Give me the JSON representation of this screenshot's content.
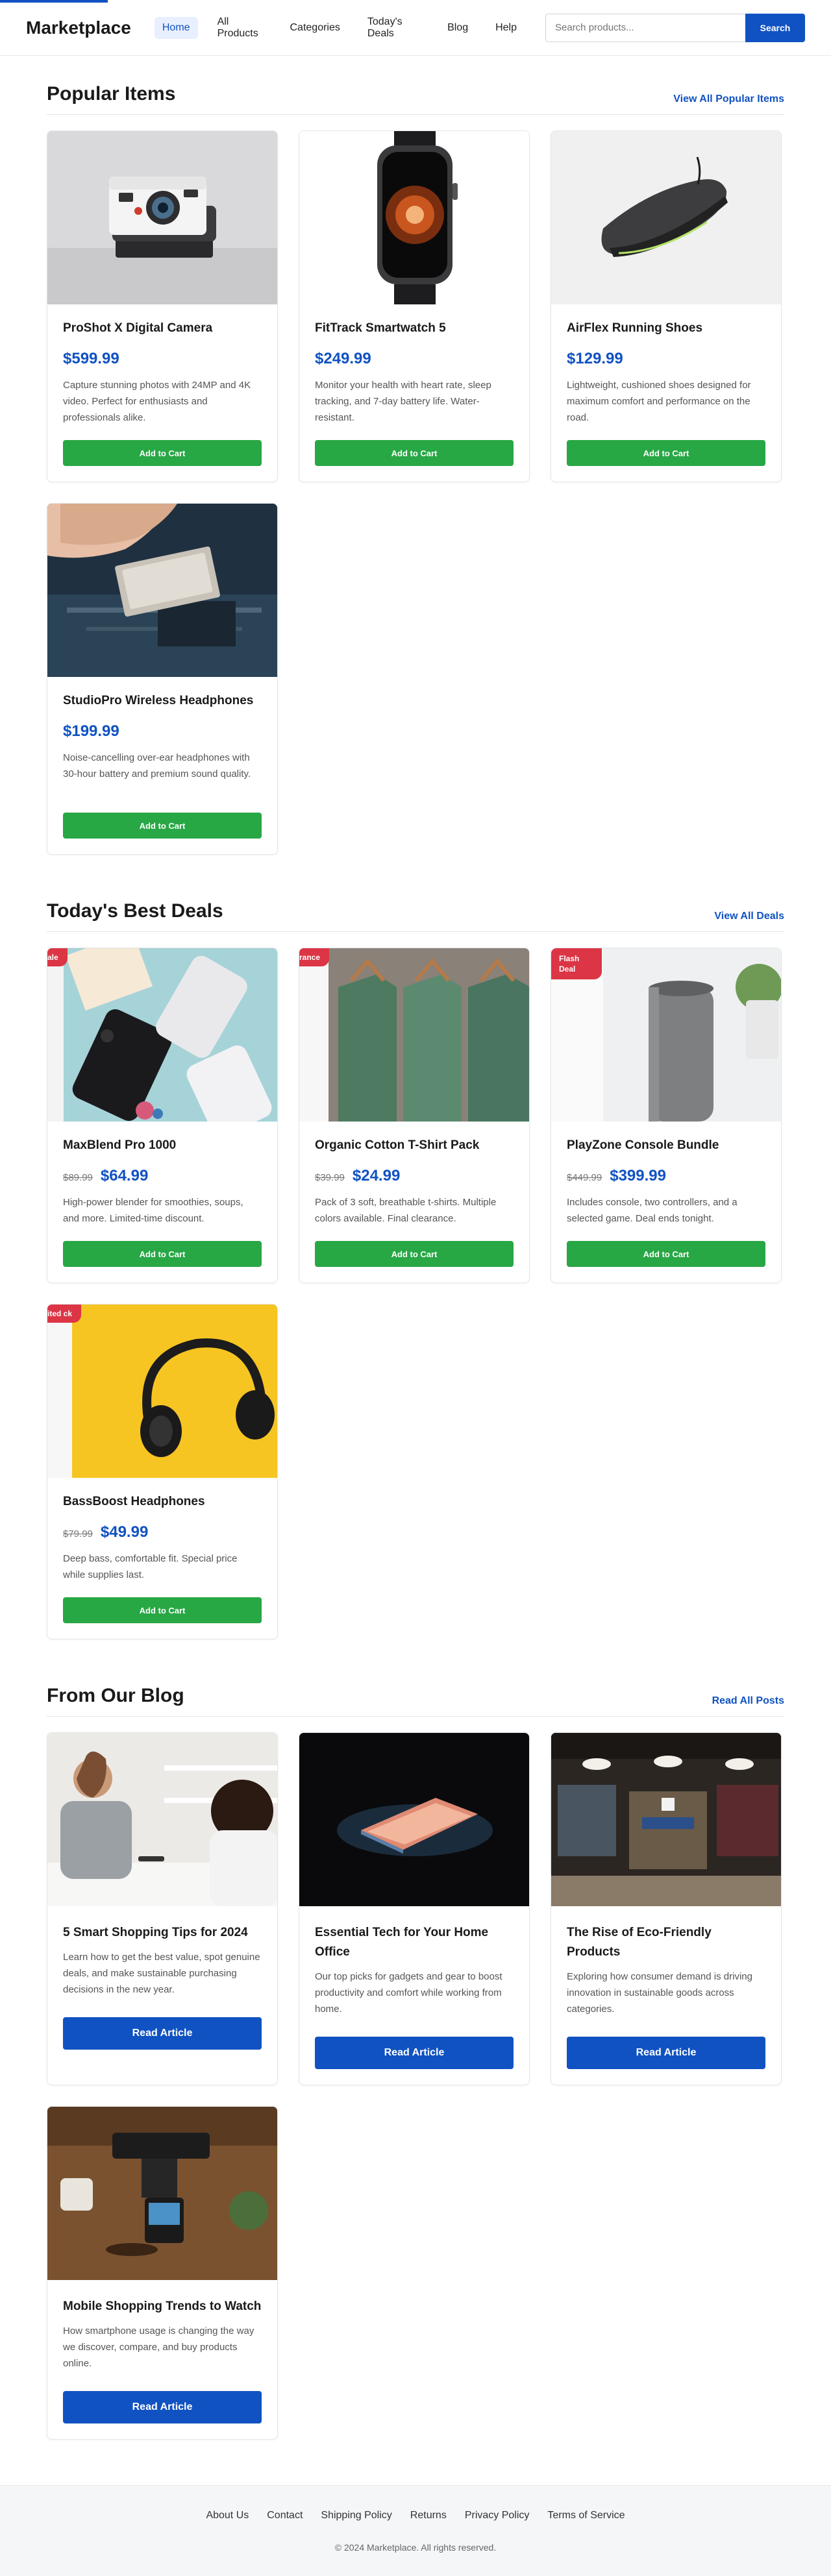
{
  "progress": {
    "fraction": 0.13
  },
  "header": {
    "logo": "Marketplace",
    "nav": [
      "Home",
      "All Products",
      "Categories",
      "Today's Deals",
      "Blog",
      "Help"
    ],
    "search_placeholder": "Search products...",
    "search_button": "Search"
  },
  "popular": {
    "title": "Popular Items",
    "link": "View All Popular Items",
    "items": [
      {
        "name": "ProShot X Digital Camera",
        "price": "$599.99",
        "desc": "Capture stunning photos with 24MP and 4K video. Perfect for enthusiasts and professionals alike.",
        "button": "Add to Cart",
        "image": "camera"
      },
      {
        "name": "FitTrack Smartwatch 5",
        "price": "$249.99",
        "desc": "Monitor your health with heart rate, sleep tracking, and 7-day battery life. Water-resistant.",
        "button": "Add to Cart",
        "image": "smartwatch"
      },
      {
        "name": "AirFlex Running Shoes",
        "price": "$129.99",
        "desc": "Lightweight, cushioned shoes designed for maximum comfort and performance on the road.",
        "button": "Add to Cart",
        "image": "running-shoe"
      },
      {
        "name": "StudioPro Wireless Headphones",
        "price": "$199.99",
        "desc": "Noise-cancelling over-ear headphones with 30-hour battery and premium sound quality.",
        "button": "Add to Cart",
        "image": "circuit-board"
      }
    ]
  },
  "deals": {
    "title": "Today's Best Deals",
    "link": "View All Deals",
    "items": [
      {
        "badge": "ale",
        "name": "MaxBlend Pro 1000",
        "old_price": "$89.99",
        "price": "$64.99",
        "desc": "High-power blender for smoothies, soups, and more. Limited-time discount.",
        "button": "Add to Cart",
        "image": "phones"
      },
      {
        "badge": "rance",
        "name": "Organic Cotton T-Shirt Pack",
        "old_price": "$39.99",
        "price": "$24.99",
        "desc": "Pack of 3 soft, breathable t-shirts. Multiple colors available. Final clearance.",
        "button": "Add to Cart",
        "image": "t-shirts"
      },
      {
        "badge": "Flash Deal",
        "name": "PlayZone Console Bundle",
        "old_price": "$449.99",
        "price": "$399.99",
        "desc": "Includes console, two controllers, and a selected game. Deal ends tonight.",
        "button": "Add to Cart",
        "image": "smart-speaker"
      },
      {
        "badge": "ited ck",
        "name": "BassBoost Headphones",
        "old_price": "$79.99",
        "price": "$49.99",
        "desc": "Deep bass, comfortable fit. Special price while supplies last.",
        "button": "Add to Cart",
        "image": "headphones"
      }
    ]
  },
  "blog": {
    "title": "From Our Blog",
    "link": "Read All Posts",
    "posts": [
      {
        "title": "5 Smart Shopping Tips for 2024",
        "desc": "Learn how to get the best value, spot genuine deals, and make sustainable purchasing decisions in the new year.",
        "button": "Read Article",
        "image": "shop-counter"
      },
      {
        "title": "Essential Tech for Your Home Office",
        "desc": "Our top picks for gadgets and gear to boost productivity and comfort while working from home.",
        "button": "Read Article",
        "image": "laptop"
      },
      {
        "title": "The Rise of Eco-Friendly Products",
        "desc": "Exploring how consumer demand is driving innovation in sustainable goods across categories.",
        "button": "Read Article",
        "image": "clothing-store"
      },
      {
        "title": "Mobile Shopping Trends to Watch",
        "desc": "How smartphone usage is changing the way we discover, compare, and buy products online.",
        "button": "Read Article",
        "image": "card-reader"
      }
    ]
  },
  "footer": {
    "links": [
      "About Us",
      "Contact",
      "Shipping Policy",
      "Returns",
      "Privacy Policy",
      "Terms of Service"
    ],
    "copyright": "© 2024 Marketplace. All rights reserved."
  },
  "colors": {
    "brand": "#1052c2",
    "cart_button": "#28a745",
    "badge": "#dc3545"
  }
}
